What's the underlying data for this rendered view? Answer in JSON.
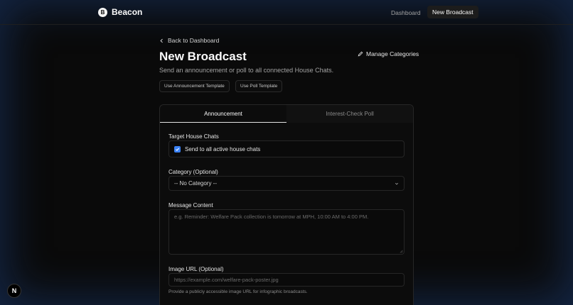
{
  "brand": {
    "logo_letter": "B",
    "name": "Beacon"
  },
  "nav": {
    "dashboard": "Dashboard",
    "new_broadcast": "New Broadcast"
  },
  "back_link": "Back to Dashboard",
  "page": {
    "title": "New Broadcast",
    "subtitle": "Send an announcement or poll to all connected House Chats.",
    "manage_categories": "Manage Categories"
  },
  "templates": {
    "announcement": "Use Announcement Template",
    "poll": "Use Poll Template"
  },
  "tabs": [
    {
      "label": "Announcement",
      "active": true
    },
    {
      "label": "Interest-Check Poll",
      "active": false
    }
  ],
  "form": {
    "target_label": "Target House Chats",
    "target_checkbox": "Send to all active house chats",
    "target_checked": true,
    "category_label": "Category (Optional)",
    "category_value": "-- No Category --",
    "message_label": "Message Content",
    "message_placeholder": "e.g. Reminder: Welfare Pack collection is tomorrow at MPH, 10:00 AM to 4:00 PM.",
    "image_label": "Image URL (Optional)",
    "image_placeholder": "https://example.com/welfare-pack-poster.jpg",
    "image_hint": "Provide a publicly accessible image URL for infographic broadcasts."
  },
  "badge": {
    "letter": "N"
  },
  "colors": {
    "accent": "#3b82f6",
    "background": "#0a0a0a"
  },
  "icons": [
    "chevron-left-icon",
    "pencil-icon",
    "check-icon",
    "chevron-down-icon",
    "resize-grip-icon"
  ]
}
